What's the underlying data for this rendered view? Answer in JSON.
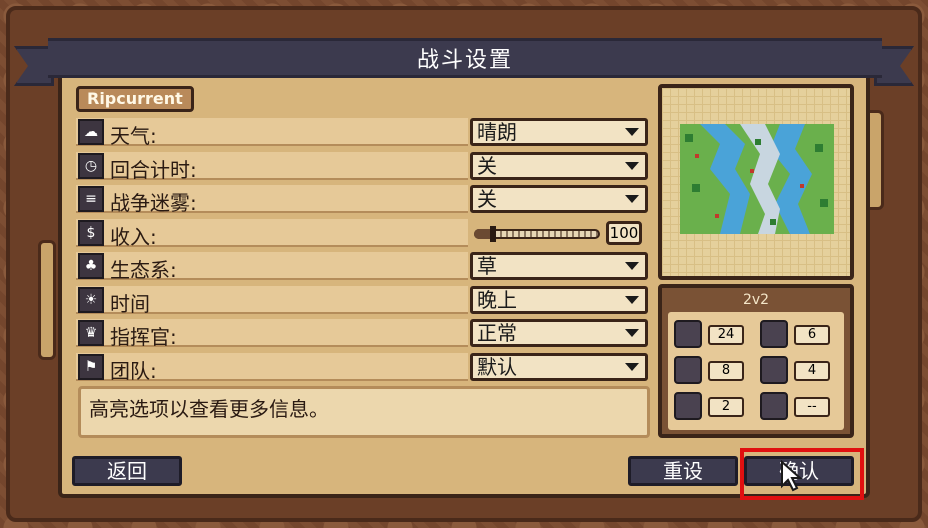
{
  "window": {
    "title": "战斗设置"
  },
  "map_name": "Ripcurrent",
  "settings": [
    {
      "icon": "weather-icon",
      "label": "天气:",
      "value": "晴朗",
      "type": "dropdown"
    },
    {
      "icon": "clock-icon",
      "label": "回合计时:",
      "value": "关",
      "type": "dropdown"
    },
    {
      "icon": "fog-icon",
      "label": "战争迷雾:",
      "value": "关",
      "type": "dropdown"
    },
    {
      "icon": "income-icon",
      "label": "收入:",
      "value": "100",
      "type": "slider",
      "level": 0.15
    },
    {
      "icon": "tree-icon",
      "label": "生态系:",
      "value": "草",
      "type": "dropdown"
    },
    {
      "icon": "sun-icon",
      "label": "时间",
      "value": "晚上",
      "type": "dropdown"
    },
    {
      "icon": "crown-icon",
      "label": "指挥官:",
      "value": "正常",
      "type": "dropdown"
    },
    {
      "icon": "flag-icon",
      "label": "团队:",
      "value": "默认",
      "type": "dropdown"
    }
  ],
  "info_text": "高亮选项以查看更多信息。",
  "team_summary": {
    "mode": "2v2",
    "units": [
      {
        "icon": "house-icon",
        "count": "24"
      },
      {
        "icon": "barracks-icon",
        "count": "6"
      },
      {
        "icon": "castle-icon",
        "count": "8"
      },
      {
        "icon": "tower-icon",
        "count": "4"
      },
      {
        "icon": "tent-icon",
        "count": "2"
      },
      {
        "icon": "hut-icon",
        "count": "--"
      }
    ]
  },
  "buttons": {
    "back": "返回",
    "reset": "重设",
    "confirm": "确认"
  }
}
